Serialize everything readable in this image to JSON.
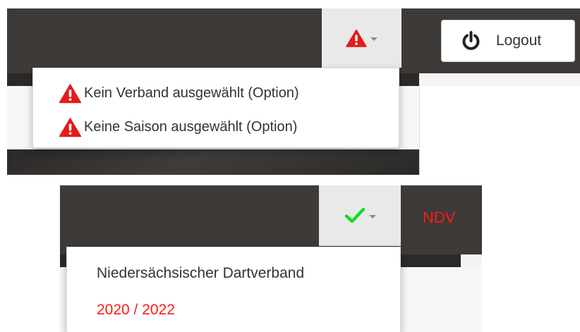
{
  "top_navbar": {
    "alert_dropdown": {
      "icon": "warning-triangle-icon",
      "icon_color": "#e31b1b",
      "items": [
        {
          "icon": "warning-triangle-icon",
          "label": "Kein Verband ausgewählt (Option)"
        },
        {
          "icon": "warning-triangle-icon",
          "label": "Keine Saison ausgewählt (Option)"
        }
      ]
    },
    "logout_button": {
      "icon": "power-icon",
      "label": "Logout"
    }
  },
  "bottom_navbar": {
    "status_dropdown": {
      "icon": "checkmark-icon",
      "icon_color": "#11dd22",
      "items": [
        {
          "label": "Niedersächsischer Dartverband"
        },
        {
          "label": "2020 / 2022"
        }
      ]
    },
    "association_short": "NDV",
    "accent_color": "#ff1a1a"
  }
}
